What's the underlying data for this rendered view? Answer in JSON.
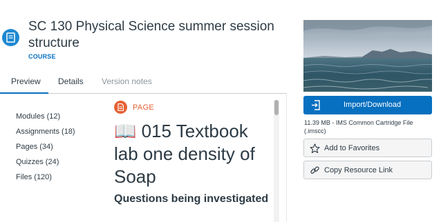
{
  "resource": {
    "title": "SC 130 Physical Science summer session structure",
    "type_label": "COURSE"
  },
  "tabs": [
    {
      "label": "Preview",
      "state": "active"
    },
    {
      "label": "Details",
      "state": "normal"
    },
    {
      "label": "Version notes",
      "state": "disabled"
    }
  ],
  "contents": [
    {
      "label": "Modules (12)"
    },
    {
      "label": "Assignments (18)"
    },
    {
      "label": "Pages (34)"
    },
    {
      "label": "Quizzes (24)"
    },
    {
      "label": "Files (120)"
    }
  ],
  "preview": {
    "badge": "PAGE",
    "title": "📖 015 Textbook lab one density of Soap",
    "heading": "Questions being investigated"
  },
  "sidebar": {
    "import_label": "Import/Download",
    "file_info": "11.39 MB - IMS Common Cartridge File (.imscc)",
    "favorites_label": "Add to Favorites",
    "copy_link_label": "Copy Resource Link"
  },
  "colors": {
    "accent": "#0770c0",
    "page_badge": "#e66135",
    "course_icon": "#1e88d2"
  },
  "icons": {
    "course": "book-icon",
    "page": "page-icon",
    "import": "import-icon",
    "favorites": "star-icon",
    "copy_link": "link-icon"
  }
}
